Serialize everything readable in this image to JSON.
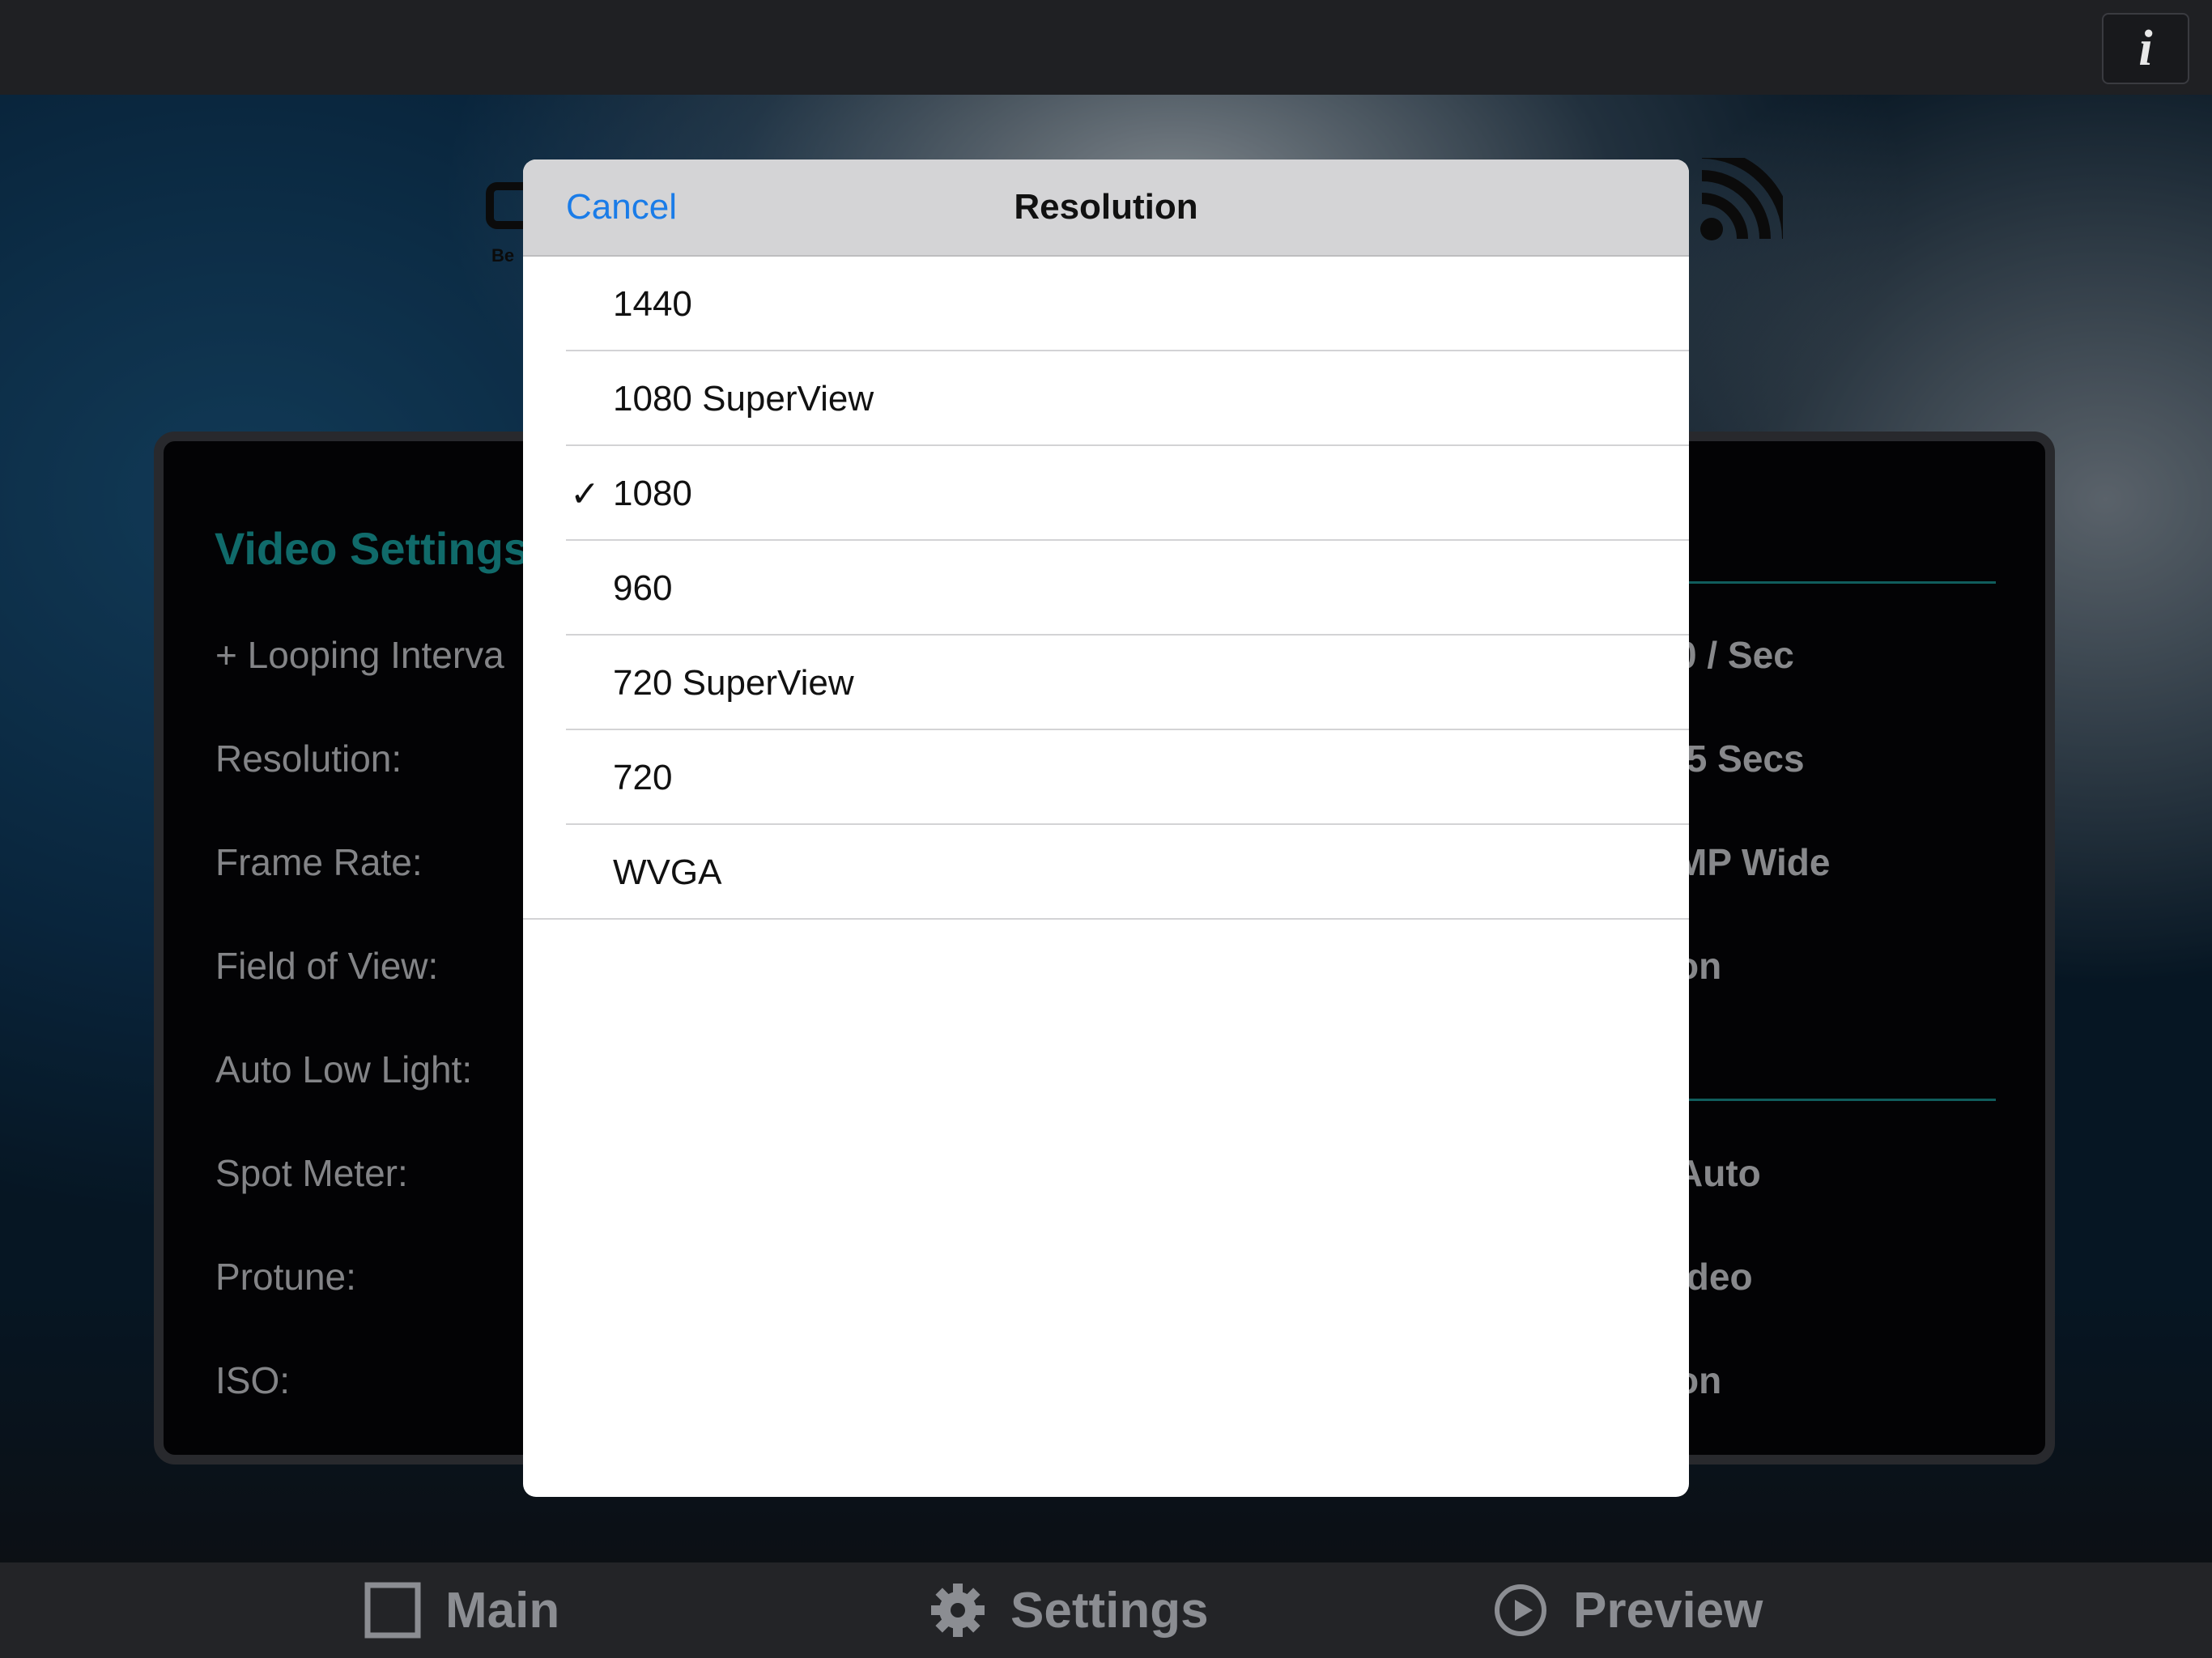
{
  "topbar": {
    "info_label": "i"
  },
  "logo": {
    "label": "Be"
  },
  "panel": {
    "title": "Video Settings",
    "rows": [
      {
        "label": "+ Looping Interva",
        "value": "0 / Sec"
      },
      {
        "label": "Resolution:",
        "value": ".5 Secs"
      },
      {
        "label": "Frame Rate:",
        "value": "MP Wide"
      },
      {
        "label": "Field of View:",
        "value": "on"
      },
      {
        "label": "Auto Low Light:",
        "value": ""
      },
      {
        "label": "Spot Meter:",
        "value": "Auto"
      },
      {
        "label": "Protune:",
        "value": "ideo"
      },
      {
        "label": "ISO:",
        "value": "on"
      }
    ]
  },
  "modal": {
    "title": "Resolution",
    "cancel_label": "Cancel",
    "options": [
      {
        "label": "1440",
        "check": ""
      },
      {
        "label": "1080 SuperView",
        "check": ""
      },
      {
        "label": "1080",
        "check": "✓"
      },
      {
        "label": "960",
        "check": ""
      },
      {
        "label": "720 SuperView",
        "check": ""
      },
      {
        "label": "720",
        "check": ""
      },
      {
        "label": "WVGA",
        "check": ""
      }
    ]
  },
  "tabs": [
    {
      "label": "Main",
      "icon": "square-icon"
    },
    {
      "label": "Settings",
      "icon": "gear-icon"
    },
    {
      "label": "Preview",
      "icon": "play-circle-icon"
    }
  ],
  "colors": {
    "accent": "#1a7ce8",
    "teal": "#1aa3a3"
  }
}
